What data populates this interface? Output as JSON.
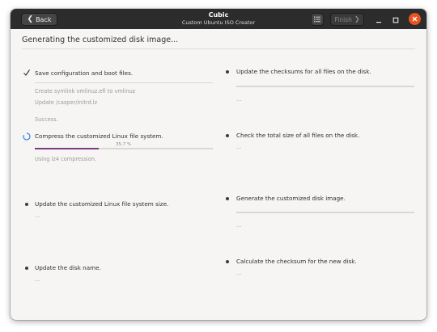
{
  "window": {
    "title": "Cubic",
    "subtitle": "Custom Ubuntu ISO Creator",
    "back_label": "Back",
    "finish_label": "Finish",
    "minimize_glyph": "–",
    "maximize_glyph": "◻",
    "close_glyph": "×",
    "back_icon": "chevron-left-icon",
    "finish_icon": "chevron-right-icon",
    "list_icon": "list-icon"
  },
  "page": {
    "heading": "Generating the customized disk image..."
  },
  "colors": {
    "progress": "#7b3a7e",
    "close_button": "#e95420",
    "titlebar": "#2c2c2c",
    "spinner": "#3584e4"
  },
  "steps": {
    "save": {
      "icon": "checkmark-icon",
      "label": "Save configuration and boot files.",
      "details": [
        "Create symlink vmlinuz.efi to vmlinuz",
        "Update /casper/initrd.lz",
        "Success."
      ]
    },
    "compress": {
      "icon": "spinner-icon",
      "label": "Compress the customized Linux file system.",
      "progress_percent": 35.7,
      "progress_text": "35.7 %",
      "details": [
        "Using lz4 compression."
      ]
    },
    "update_size": {
      "icon": "bullet-icon",
      "label": "Update the customized Linux file system size.",
      "details": [
        "..."
      ]
    },
    "update_name": {
      "icon": "bullet-icon",
      "label": "Update the disk name.",
      "details": [
        "..."
      ]
    },
    "checksums": {
      "icon": "bullet-icon",
      "label": "Update the checksums for all files on the disk.",
      "progress_percent": 0,
      "details": [
        "..."
      ]
    },
    "total_size": {
      "icon": "bullet-icon",
      "label": "Check the total size of all files on the disk.",
      "details": [
        "..."
      ]
    },
    "generate": {
      "icon": "bullet-icon",
      "label": "Generate the customized disk image.",
      "progress_percent": 0,
      "details": [
        "..."
      ]
    },
    "checksum_disk": {
      "icon": "bullet-icon",
      "label": "Calculate the checksum for the new disk.",
      "details": [
        "..."
      ]
    }
  }
}
